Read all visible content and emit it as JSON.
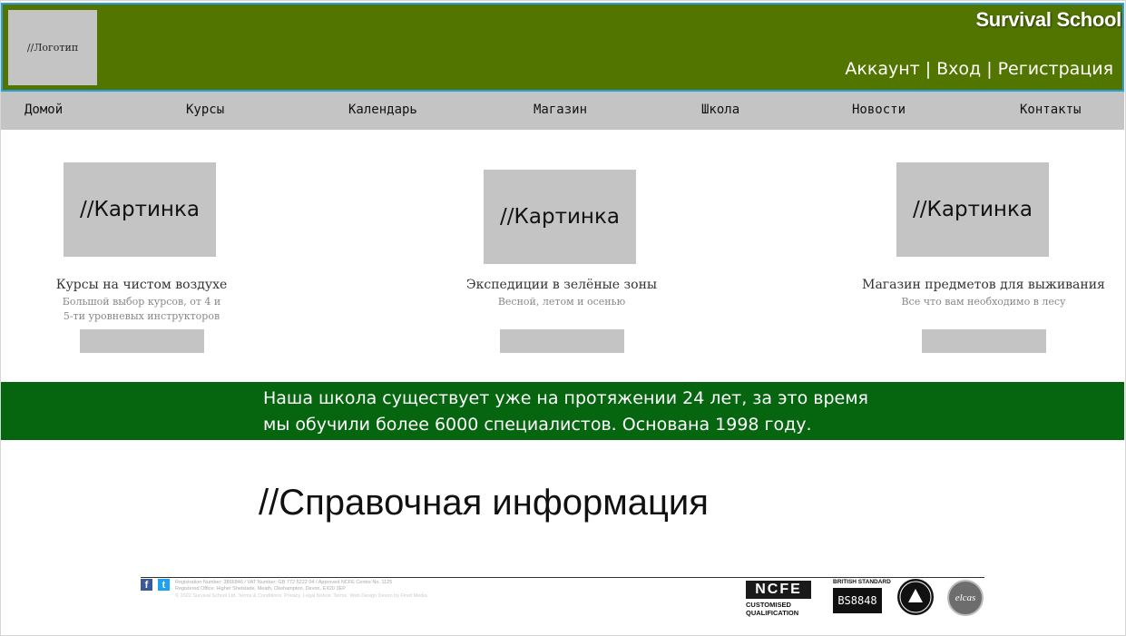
{
  "header": {
    "logo_text": "//Логотип",
    "brand": "Survival School",
    "account": "Аккаунт",
    "login": "Вход",
    "register": "Регистрация",
    "separator": "|"
  },
  "nav": {
    "items": [
      "Домой",
      "Курсы",
      "Календарь",
      "Магазин",
      "Школа",
      "Новости",
      "Контакты"
    ]
  },
  "cards": [
    {
      "image_label": "//Картинка",
      "title": "Курсы на чистом воздухе",
      "subtitle_line1": "Большой выбор курсов, от 4 и",
      "subtitle_line2": "5-ти уровневых инструкторов"
    },
    {
      "image_label": "//Картинка",
      "title": "Экспедиции в зелёные зоны",
      "subtitle_line1": "Весной, летом и осенью",
      "subtitle_line2": ""
    },
    {
      "image_label": "//Картинка",
      "title": "Магазин предметов для выживания",
      "subtitle_line1": "Все что вам необходимо в лесу",
      "subtitle_line2": ""
    }
  ],
  "banner": {
    "line1": "Наша школа существует уже на протяжении 24 лет, за это время",
    "line2": "мы обучили более 6000 специалистов. Основана 1998 году."
  },
  "reference_title": "//Справочная информация",
  "footer": {
    "facebook_glyph": "f",
    "twitter_glyph": "t",
    "line1": "Registration Number: 3866846 / VAT Number: GB 772 5222 04 / Approved NCFE Centre No. 1125",
    "line2": "Registered Office: Higher Shelstade, Meath, Okehampton, Devon, EX20 3EP",
    "line3": "© 2022 Survival School Ltd. Terms & Conditions. Privacy. Legal Notice. Terms. Web Design Devon by Fired Media",
    "ncfe_logo": "NCFE",
    "ncfe_caption1": "CUSTOMISED",
    "ncfe_caption2": "QUALIFICATION",
    "bsi_caption": "BRITISH STANDARD",
    "bsi_code": "BS8848",
    "badge1_text": "BUY WITH CONFIDENCE",
    "badge2_text": "elcas"
  },
  "colors": {
    "header_bg": "#527500",
    "header_border": "#2a9ee0",
    "nav_bg": "#c4c4c4",
    "banner_bg": "#05660f",
    "placeholder_gray": "#c4c4c4"
  }
}
